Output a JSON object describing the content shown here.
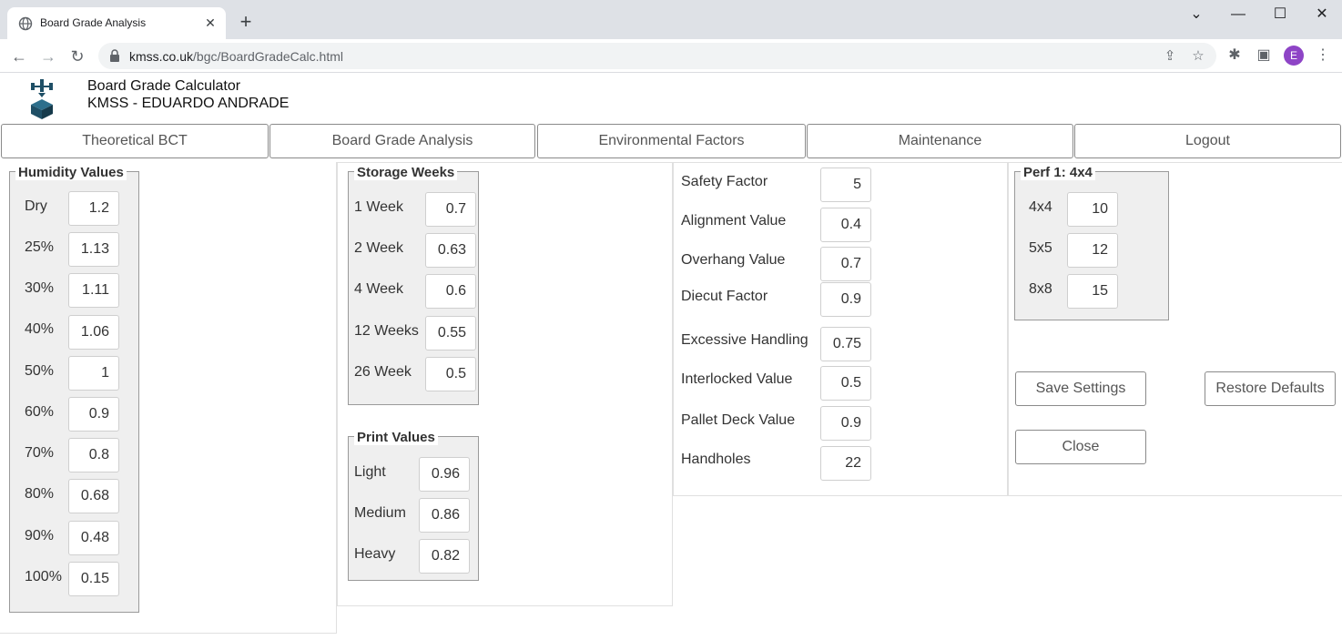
{
  "browser": {
    "tab_title": "Board Grade Analysis",
    "url_domain": "kmss.co.uk",
    "url_path": "/bgc/BoardGradeCalc.html",
    "profile_initial": "E",
    "icons": [
      "globe-icon",
      "close-icon",
      "plus-icon",
      "back-icon",
      "forward-icon",
      "reload-icon",
      "lock-icon",
      "share-icon",
      "star-icon",
      "extensions-icon",
      "sidepanel-icon",
      "menu-icon"
    ]
  },
  "app": {
    "title": "Board Grade Calculator",
    "user": "KMSS - EDUARDO ANDRADE"
  },
  "nav": {
    "tabs": [
      "Theoretical BCT",
      "Board Grade Analysis",
      "Environmental Factors",
      "Maintenance",
      "Logout"
    ]
  },
  "humidity": {
    "legend": "Humidity Values",
    "rows": [
      {
        "label": "Dry",
        "value": "1.2"
      },
      {
        "label": "25%",
        "value": "1.13"
      },
      {
        "label": "30%",
        "value": "1.11"
      },
      {
        "label": "40%",
        "value": "1.06"
      },
      {
        "label": "50%",
        "value": "1"
      },
      {
        "label": "60%",
        "value": "0.9"
      },
      {
        "label": "70%",
        "value": "0.8"
      },
      {
        "label": "80%",
        "value": "0.68"
      },
      {
        "label": "90%",
        "value": "0.48"
      },
      {
        "label": "100%",
        "value": "0.15"
      }
    ]
  },
  "storage": {
    "legend": "Storage Weeks",
    "rows": [
      {
        "label": "1 Week",
        "value": "0.7"
      },
      {
        "label": "2 Week",
        "value": "0.63"
      },
      {
        "label": "4 Week",
        "value": "0.6"
      },
      {
        "label": "12 Weeks",
        "value": "0.55"
      },
      {
        "label": "26 Week",
        "value": "0.5"
      }
    ]
  },
  "print": {
    "legend": "Print Values",
    "rows": [
      {
        "label": "Light",
        "value": "0.96"
      },
      {
        "label": "Medium",
        "value": "0.86"
      },
      {
        "label": "Heavy",
        "value": "0.82"
      }
    ]
  },
  "factors": {
    "rows": [
      {
        "label": "Safety Factor",
        "value": "5"
      },
      {
        "label": "Alignment Value",
        "value": "0.4"
      },
      {
        "label": "Overhang Value",
        "value": "0.7"
      },
      {
        "label": "Diecut Factor",
        "value": "0.9"
      },
      {
        "label": "Excessive Handling",
        "value": "0.75"
      },
      {
        "label": "Interlocked Value",
        "value": "0.5"
      },
      {
        "label": "Pallet Deck Value",
        "value": "0.9"
      },
      {
        "label": "Handholes",
        "value": "22"
      }
    ]
  },
  "perf": {
    "legend": "Perf 1: 4x4",
    "rows": [
      {
        "label": "4x4",
        "value": "10"
      },
      {
        "label": "5x5",
        "value": "12"
      },
      {
        "label": "8x8",
        "value": "15"
      }
    ]
  },
  "actions": {
    "save": "Save Settings",
    "restore": "Restore Defaults",
    "close": "Close"
  }
}
